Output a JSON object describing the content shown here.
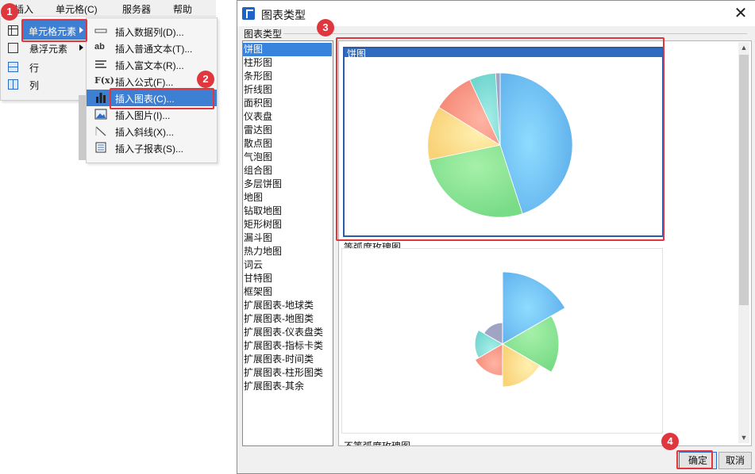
{
  "menubar": {
    "items": [
      "插入",
      "单元格(C)",
      "服务器",
      "帮助"
    ]
  },
  "column_menu": {
    "items": [
      {
        "label": "单元格元素",
        "icon": "cell-grid-icon",
        "has_submenu": true,
        "selected": true
      },
      {
        "label": "悬浮元素",
        "icon": "float-box-icon",
        "has_submenu": true,
        "selected": false
      },
      {
        "label": "行",
        "icon": "row-icon",
        "has_submenu": false,
        "selected": false
      },
      {
        "label": "列",
        "icon": "column-icon",
        "has_submenu": false,
        "selected": false
      }
    ]
  },
  "submenu": {
    "items": [
      {
        "label": "插入数据列(D)...",
        "icon": "data-column-icon",
        "glyph": "▭"
      },
      {
        "label": "插入普通文本(T)...",
        "icon": "text-ab-icon",
        "glyph": "ab"
      },
      {
        "label": "插入富文本(R)...",
        "icon": "rich-text-icon",
        "glyph": "≡"
      },
      {
        "label": "插入公式(F)...",
        "icon": "formula-icon",
        "glyph": "F(x)"
      },
      {
        "label": "插入图表(C)...",
        "icon": "bar-chart-icon",
        "glyph": "▌▌",
        "selected": true
      },
      {
        "label": "插入图片(I)...",
        "icon": "image-icon",
        "glyph": "▣"
      },
      {
        "label": "插入斜线(X)...",
        "icon": "slash-icon",
        "glyph": "╲"
      },
      {
        "label": "插入子报表(S)...",
        "icon": "subreport-icon",
        "glyph": "▤"
      }
    ]
  },
  "dialog": {
    "title": "图表类型",
    "close_label": "✕",
    "group_label": "图表类型",
    "chart_types": [
      "饼图",
      "柱形图",
      "条形图",
      "折线图",
      "面积图",
      "仪表盘",
      "雷达图",
      "散点图",
      "气泡图",
      "组合图",
      "多层饼图",
      "地图",
      "钻取地图",
      "矩形树图",
      "漏斗图",
      "热力地图",
      "词云",
      "甘特图",
      "框架图",
      "扩展图表-地球类",
      "扩展图表-地图类",
      "扩展图表-仪表盘类",
      "扩展图表-指标卡类",
      "扩展图表-时间类",
      "扩展图表-柱形图类",
      "扩展图表-其余"
    ],
    "selected_index": 0,
    "previews": [
      {
        "label": "饼图",
        "selected": true
      },
      {
        "label": "等弧度玫瑰图",
        "selected": false
      },
      {
        "label": "不等弧度玫瑰图",
        "selected": false
      }
    ],
    "ok_label": "确定",
    "cancel_label": "取消"
  },
  "callouts": [
    "1",
    "2",
    "3",
    "4"
  ],
  "colors": {
    "accent_blue": "#3c7fd3",
    "callout_red": "#e0363d",
    "pie_blue": "#6db8ee",
    "pie_green": "#82df8c",
    "pie_yellow": "#fad77e",
    "pie_red": "#f79381",
    "pie_teal": "#7fdcd6",
    "pie_purple": "#9fa3c4"
  }
}
